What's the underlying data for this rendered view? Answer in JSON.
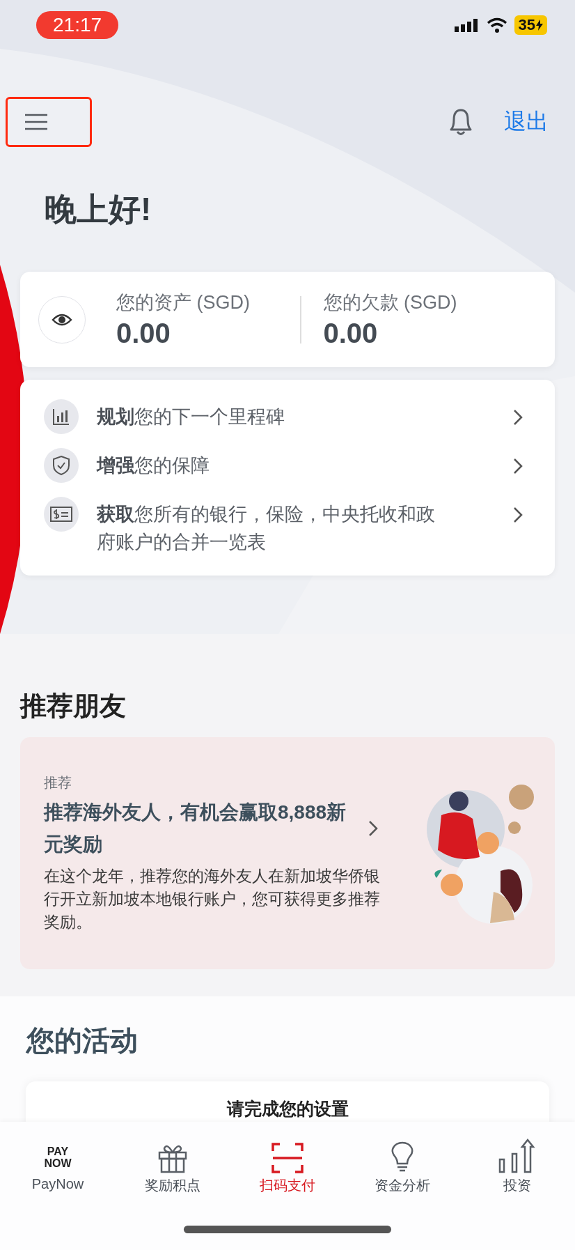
{
  "status_bar": {
    "time": "21:17",
    "battery": "35"
  },
  "header": {
    "menu_highlighted": true,
    "logout": "退出"
  },
  "greeting": "晚上好!",
  "balances": [
    {
      "label": "您的资产 (SGD)",
      "amount": "0.00"
    },
    {
      "label": "您的欠款 (SGD)",
      "amount": "0.00"
    }
  ],
  "links": [
    {
      "kind": "chart",
      "text": "**规划**您的下一个里程碑"
    },
    {
      "kind": "shield",
      "text": "**增强**您的保障"
    },
    {
      "kind": "statement",
      "text": "**获取**您所有的银行，保险，中央托收和政府账户的合并一览表"
    }
  ],
  "referral_section": {
    "title": "推荐朋友",
    "tag": "推荐",
    "headline": "推荐海外友人，有机会赢取8,888新元奖励",
    "body": "在这个龙年，推荐您的海外友人在新加坡华侨银行开立新加坡本地银行账户，您可获得更多推荐奖励。"
  },
  "activity_section": {
    "title": "您的活动",
    "card_title": "请完成您的设置"
  },
  "nav": [
    {
      "kind": "paynow",
      "label": "PayNow",
      "logo": [
        "PAY",
        "NOW"
      ],
      "selected": false
    },
    {
      "kind": "gift",
      "label": "奖励积点",
      "selected": false
    },
    {
      "kind": "scan",
      "label": "扫码支付",
      "selected": true
    },
    {
      "kind": "bulb",
      "label": "资金分析",
      "selected": false
    },
    {
      "kind": "invest",
      "label": "投资",
      "selected": false
    }
  ]
}
